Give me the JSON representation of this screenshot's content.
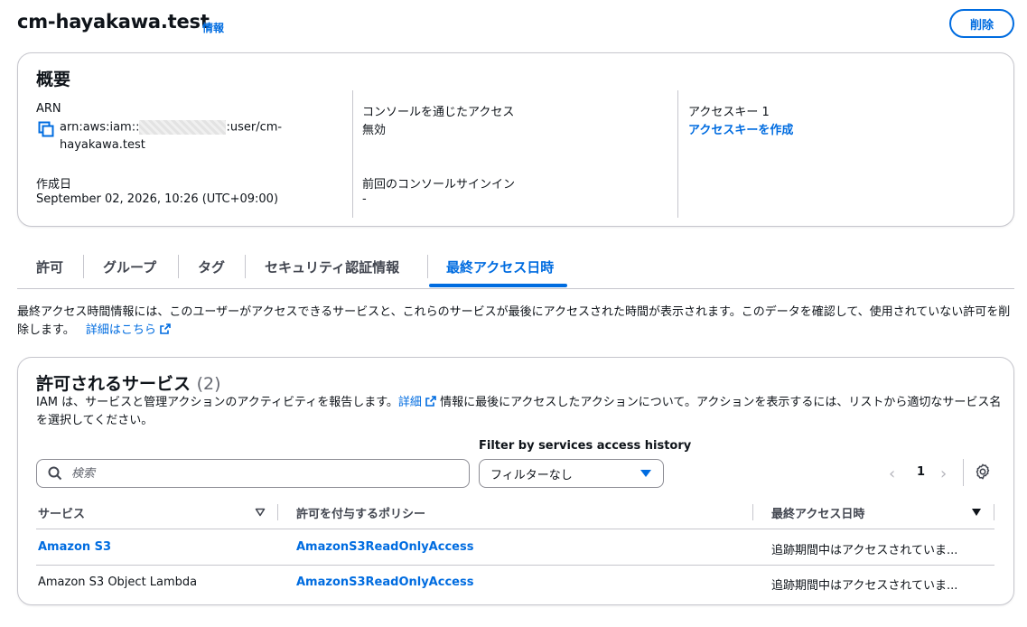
{
  "header": {
    "title": "cm-hayakawa.test",
    "info_label": "情報",
    "delete_label": "削除"
  },
  "summary": {
    "heading": "概要",
    "arn_label": "ARN",
    "arn_prefix": "arn:aws:iam::",
    "arn_suffix": ":user/cm-",
    "arn_line2": "hayakawa.test",
    "created_label": "作成日",
    "created_value": "September 02, 2026, 10:26 (UTC+09:00)",
    "console_access_label": "コンソールを通じたアクセス",
    "console_access_value": "無効",
    "last_signin_label": "前回のコンソールサインイン",
    "last_signin_value": "-",
    "access_key_label": "アクセスキー 1",
    "create_access_key_label": "アクセスキーを作成"
  },
  "tabs": [
    {
      "label": "許可"
    },
    {
      "label": "グループ"
    },
    {
      "label": "タグ"
    },
    {
      "label": "セキュリティ認証情報"
    },
    {
      "label": "最終アクセス日時"
    }
  ],
  "description": {
    "text": "最終アクセス時間情報には、このユーザーがアクセスできるサービスと、これらのサービスが最後にアクセスされた時間が表示されます。このデータを確認して、使用されていない許可を削除します。",
    "link": "詳細はこちら"
  },
  "services": {
    "heading": "許可されるサービス",
    "count": "(2)",
    "desc_before": "IAM は、サービスと管理アクションのアクティビティを報告します。",
    "desc_link": "詳細",
    "desc_after": "情報に最後にアクセスしたアクションについて。アクションを表示するには、リストから適切なサービス名を選択してください。",
    "search_placeholder": "検索",
    "filter_label": "Filter by services access history",
    "filter_value": "フィルターなし",
    "page_number": "1",
    "columns": [
      "サービス",
      "許可を付与するポリシー",
      "最終アクセス日時"
    ],
    "rows": [
      {
        "service": "Amazon S3",
        "policy": "AmazonS3ReadOnlyAccess",
        "last_accessed": "追跡期間中はアクセスされていま..."
      },
      {
        "service": "Amazon S3 Object Lambda",
        "policy": "AmazonS3ReadOnlyAccess",
        "last_accessed": "追跡期間中はアクセスされていま..."
      }
    ]
  },
  "colors": {
    "link": "#006ce0",
    "border": "#c6c6cd",
    "text": "#0f141a"
  }
}
